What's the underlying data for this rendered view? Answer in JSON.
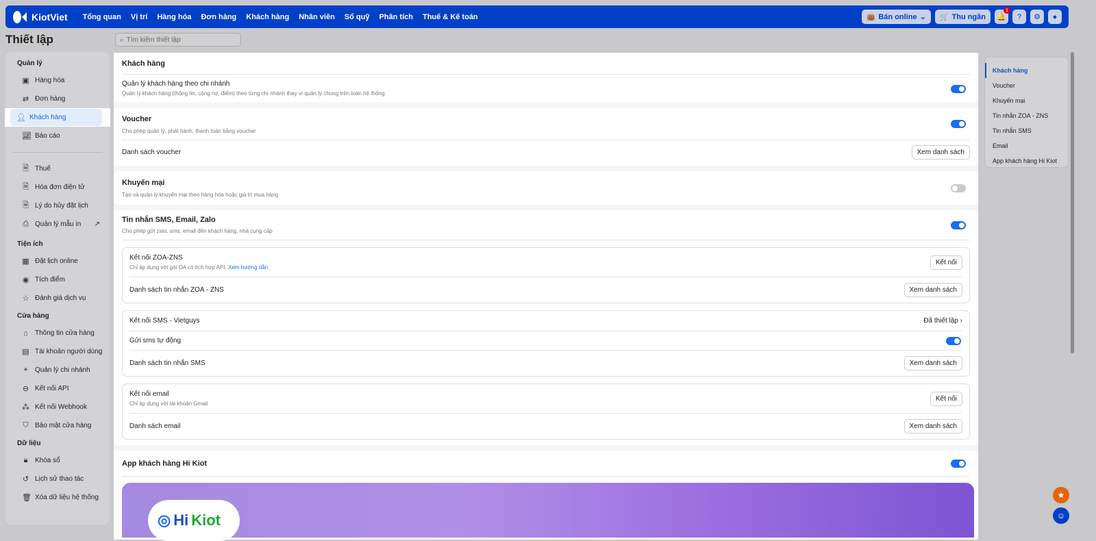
{
  "header": {
    "brand": "KiotViet",
    "nav": [
      "Tổng quan",
      "Vị trí",
      "Hàng hóa",
      "Đơn hàng",
      "Khách hàng",
      "Nhân viên",
      "Sổ quỹ",
      "Phân tích",
      "Thuế & Kế toán"
    ],
    "ban_online": "Bán online",
    "thu_ngan": "Thu ngân",
    "notif_count": "1"
  },
  "page": {
    "title": "Thiết lập",
    "search_placeholder": "Tìm kiếm thiết lập"
  },
  "sidebar": {
    "groups": [
      {
        "title": "Quản lý",
        "items": [
          "Hàng hóa",
          "Đơn hàng",
          "Khách hàng",
          "Báo cáo"
        ]
      },
      {
        "title": "",
        "items": [
          "Thuế",
          "Hóa đơn điện tử",
          "Lý do hủy đặt lịch",
          "Quản lý mẫu in"
        ]
      },
      {
        "title": "Tiện ích",
        "items": [
          "Đặt lịch online",
          "Tích điểm",
          "Đánh giá dịch vụ"
        ]
      },
      {
        "title": "Cửa hàng",
        "items": [
          "Thông tin cửa hàng",
          "Tài khoản người dùng",
          "Quản lý chi nhánh",
          "Kết nối API",
          "Kết nối Webhook",
          "Bảo mật cửa hàng"
        ]
      },
      {
        "title": "Dữ liệu",
        "items": [
          "Khóa sổ",
          "Lịch sử thao tác",
          "Xóa dữ liệu hệ thống"
        ]
      }
    ],
    "active": "Khách hàng"
  },
  "main": {
    "khach_hang": {
      "title": "Khách hàng",
      "setting": "Quản lý khách hàng theo chi nhánh",
      "desc": "Quản lý khách hàng (thông tin, công nợ, điểm) theo từng chi nhánh thay vì quản lý chung trên toàn hệ thống.",
      "enabled": true
    },
    "voucher": {
      "title": "Voucher",
      "desc": "Cho phép quản lý, phát hành, thanh toán bằng voucher",
      "enabled": true,
      "list": "Danh sách voucher",
      "btn": "Xem danh sách"
    },
    "khuyen_mai": {
      "title": "Khuyến mại",
      "desc": "Tạo và quản lý khuyến mại theo hàng hóa hoặc giá trị mua hàng",
      "enabled": false
    },
    "tin_nhan": {
      "title": "Tin nhắn SMS, Email, Zalo",
      "desc": "Cho phép gửi zalo, sms, email đến khách hàng, nhà cung cấp",
      "enabled": true,
      "zns": {
        "title": "Kết nối ZOA-ZNS",
        "desc": "Chỉ áp dụng với gói OA có tích hợp API.",
        "link": "Xem hướng dẫn",
        "btn": "Kết nối",
        "list": "Danh sách tin nhắn ZOA - ZNS",
        "list_btn": "Xem danh sách"
      },
      "sms": {
        "title": "Kết nối SMS - Vietguys",
        "status": "Đã thiết lập",
        "auto": "Gửi sms tự động",
        "auto_enabled": true,
        "list": "Danh sách tin nhắn SMS",
        "list_btn": "Xem danh sách"
      },
      "email": {
        "title": "Kết nối email",
        "desc": "Chỉ áp dụng với tài khoản Gmail",
        "btn": "Kết nối",
        "list": "Danh sách email",
        "list_btn": "Xem danh sách"
      }
    },
    "app": {
      "title": "App khách hàng Hi Kiot",
      "enabled": true,
      "logo": "Hi Kiot"
    }
  },
  "right_nav": [
    "Khách hàng",
    "Voucher",
    "Khuyến mại",
    "Tin nhắn ZOA - ZNS",
    "Tin nhắn SMS",
    "Email",
    "App khách hàng Hi Kiot"
  ]
}
